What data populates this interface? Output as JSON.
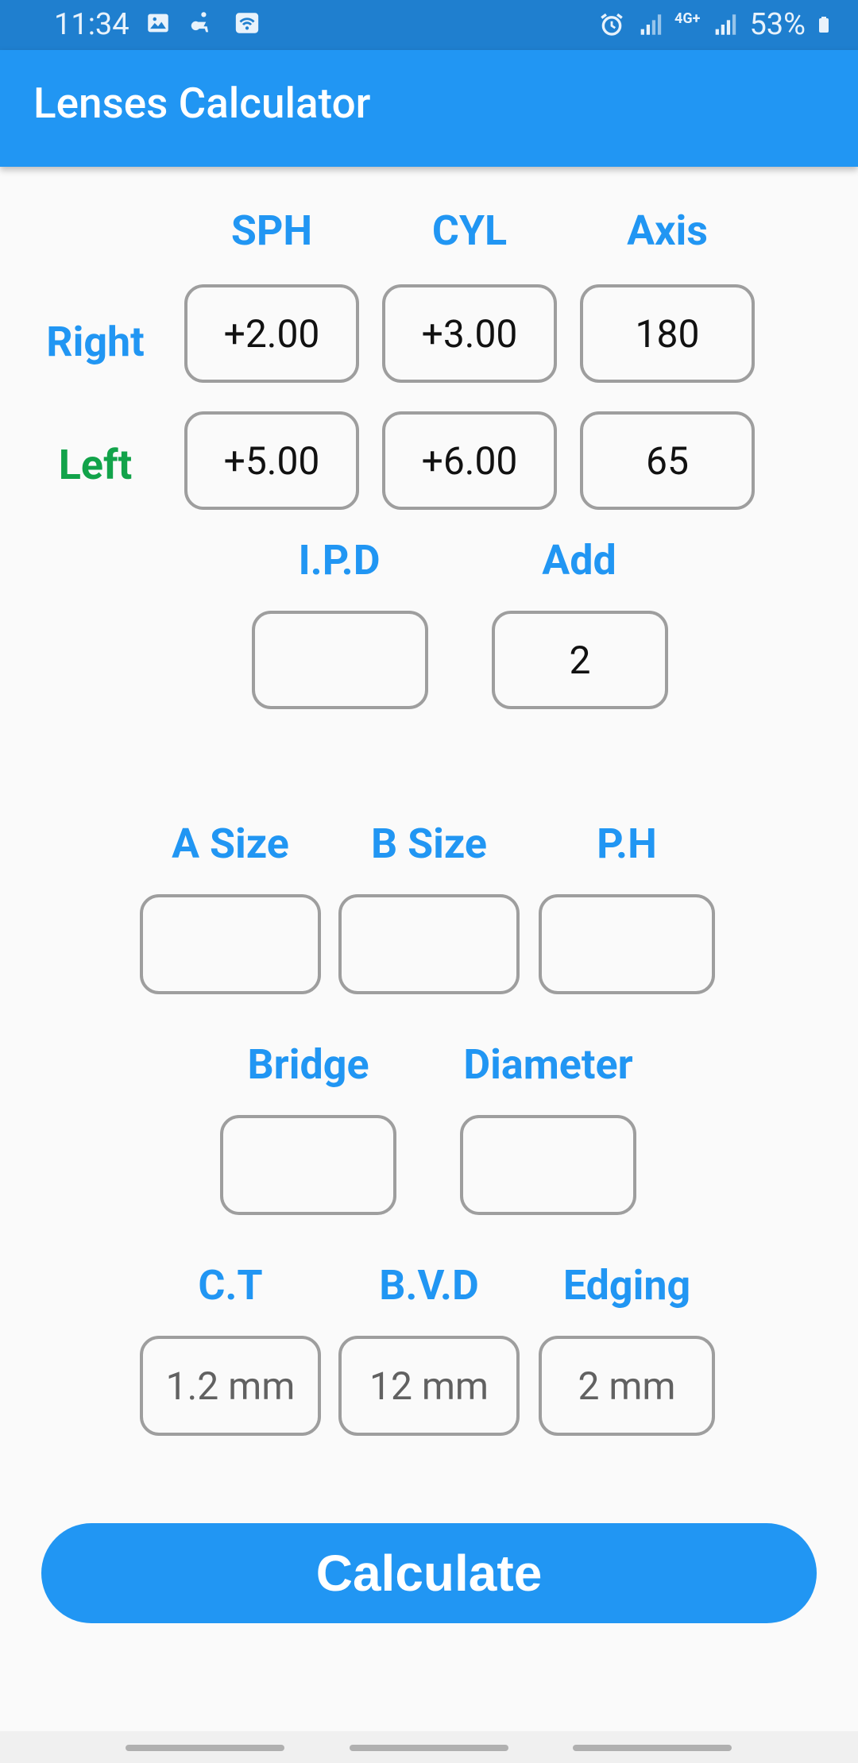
{
  "status_bar": {
    "time": "11:34",
    "network": "4G+",
    "battery": "53%"
  },
  "app_bar": {
    "title": "Lenses Calculator"
  },
  "prescription": {
    "headers": {
      "sph": "SPH",
      "cyl": "CYL",
      "axis": "Axis"
    },
    "rows": [
      {
        "label": "Right",
        "sph": "+2.00",
        "cyl": "+3.00",
        "axis": "180"
      },
      {
        "label": "Left",
        "sph": "+5.00",
        "cyl": "+6.00",
        "axis": "65"
      }
    ]
  },
  "ipd_add": {
    "ipd_label": "I.P.D",
    "ipd_value": "",
    "add_label": "Add",
    "add_value": "2"
  },
  "frame": {
    "a_size_label": "A Size",
    "a_size_value": "",
    "b_size_label": "B Size",
    "b_size_value": "",
    "ph_label": "P.H",
    "ph_value": ""
  },
  "bridge_diameter": {
    "bridge_label": "Bridge",
    "bridge_value": "",
    "diameter_label": "Diameter",
    "diameter_value": ""
  },
  "lens_params": {
    "ct_label": "C.T",
    "ct_placeholder": "1.2 mm",
    "bvd_label": "B.V.D",
    "bvd_placeholder": "12 mm",
    "edging_label": "Edging",
    "edging_placeholder": "2 mm"
  },
  "actions": {
    "calculate_label": "Calculate"
  },
  "colors": {
    "accent": "#2196f3",
    "status_bar": "#1f7fcf",
    "left_label": "#12a34a",
    "field_border": "#9e9e9e"
  }
}
